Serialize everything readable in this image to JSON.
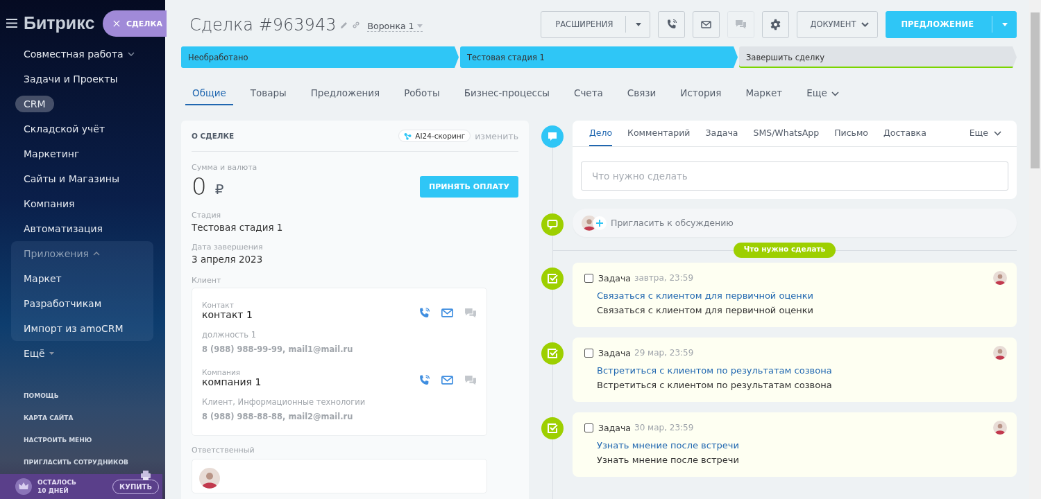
{
  "sidebar": {
    "logo_name": "Битрикс",
    "slider_tab": "СДЕЛКА",
    "items": [
      {
        "label": "Совместная работа",
        "kind": "group",
        "expanded": false
      },
      {
        "label": "Задачи и Проекты",
        "kind": "link",
        "selected": false
      },
      {
        "label": "CRM",
        "kind": "link",
        "selected": true
      },
      {
        "label": "Складской учёт",
        "kind": "link",
        "selected": false
      },
      {
        "label": "Маркетинг",
        "kind": "link",
        "selected": false
      },
      {
        "label": "Сайты и Магазины",
        "kind": "link",
        "selected": false
      },
      {
        "label": "Компания",
        "kind": "link",
        "selected": false
      },
      {
        "label": "Автоматизация",
        "kind": "link",
        "selected": false
      },
      {
        "label": "Приложения",
        "kind": "group",
        "expanded": true,
        "children": [
          {
            "label": "Маркет",
            "selected": false
          },
          {
            "label": "Разработчикам",
            "selected": false
          },
          {
            "label": "Импорт из amoCRM",
            "selected": false
          }
        ]
      },
      {
        "label": "Ещё",
        "kind": "more"
      }
    ],
    "footer_links": [
      "ПОМОЩЬ",
      "КАРТА САЙТА",
      "НАСТРОИТЬ МЕНЮ",
      "ПРИГЛАСИТЬ СОТРУДНИКОВ"
    ],
    "trial": {
      "line1": "ОСТАЛОСЬ",
      "line2": "10 ДНЕЙ",
      "button": "КУПИТЬ"
    }
  },
  "header": {
    "title": "Сделка #963943",
    "funnel": "Воронка 1",
    "buttons": [
      {
        "kind": "split",
        "label": "РАСШИРЕНИЯ",
        "disabled": false
      },
      {
        "kind": "phone",
        "disabled": false
      },
      {
        "kind": "mail",
        "disabled": false
      },
      {
        "kind": "chat",
        "disabled": true
      },
      {
        "kind": "settings",
        "disabled": false
      },
      {
        "kind": "dropdown",
        "label": "ДОКУМЕНТ",
        "disabled": false
      },
      {
        "kind": "primary",
        "label": "ПРЕДЛОЖЕНИЕ",
        "disabled": false
      }
    ]
  },
  "stages": [
    {
      "label": "Необработано",
      "kind": "stage",
      "reached": true
    },
    {
      "label": "Тестовая стадия 1",
      "kind": "stage",
      "reached": true
    },
    {
      "label": "Завершить сделку",
      "kind": "final",
      "reached": false
    }
  ],
  "tabs": [
    {
      "label": "Общие",
      "selected": true
    },
    {
      "label": "Товары",
      "selected": false
    },
    {
      "label": "Предложения",
      "selected": false
    },
    {
      "label": "Роботы",
      "selected": false
    },
    {
      "label": "Бизнес-процессы",
      "selected": false
    },
    {
      "label": "Счета",
      "selected": false
    },
    {
      "label": "Связи",
      "selected": false
    },
    {
      "label": "История",
      "selected": false
    },
    {
      "label": "Маркет",
      "selected": false
    },
    {
      "label": "Еще",
      "selected": false
    }
  ],
  "about": {
    "title": "О СДЕЛКЕ",
    "scoring": "AI24-скоринг",
    "edit": "изменить",
    "amount_label": "Сумма и валюта",
    "amount": "0",
    "currency": "₽",
    "pay_button": "ПРИНЯТЬ ОПЛАТУ",
    "fields": [
      {
        "label": "Стадия",
        "value": "Тестовая стадия 1"
      },
      {
        "label": "Дата завершения",
        "value": "3 апреля 2023"
      }
    ],
    "client_label": "Клиент",
    "clients": [
      {
        "type": "Контакт",
        "name": "контакт 1",
        "detail": "должность 1",
        "contacts": "8 (988) 988-99-99, mail1@mail.ru"
      },
      {
        "type": "Компания",
        "name": "компания 1",
        "detail": "Клиент, Информационные технологии",
        "contacts": "8 (988) 988-88-88, mail2@mail.ru"
      }
    ],
    "responsible_label": "Ответственный"
  },
  "timeline": {
    "composer": {
      "tabs": [
        {
          "label": "Дело",
          "selected": true
        },
        {
          "label": "Комментарий",
          "selected": false
        },
        {
          "label": "Задача",
          "selected": false
        },
        {
          "label": "SMS/WhatsApp",
          "selected": false
        },
        {
          "label": "Письмо",
          "selected": false
        },
        {
          "label": "Доставка",
          "selected": false
        }
      ],
      "more": "Еще",
      "placeholder": "Что нужно сделать"
    },
    "invite": "Пригласить к обсуждению",
    "divider": "Что нужно сделать",
    "tasks": [
      {
        "type": "Задача",
        "due": "завтра, 23:59",
        "title": "Связаться с клиентом для первичной оценки",
        "text": "Связаться с клиентом для первичной оценки",
        "done": false
      },
      {
        "type": "Задача",
        "due": "29 мар, 23:59",
        "title": "Встретиться с клиентом по результатам созвона",
        "text": "Встретиться с клиентом по результатам созвона",
        "done": false
      },
      {
        "type": "Задача",
        "due": "30 мар, 23:59",
        "title": "Узнать мнение после встречи",
        "text": "Узнать мнение после встречи",
        "done": false
      }
    ]
  }
}
